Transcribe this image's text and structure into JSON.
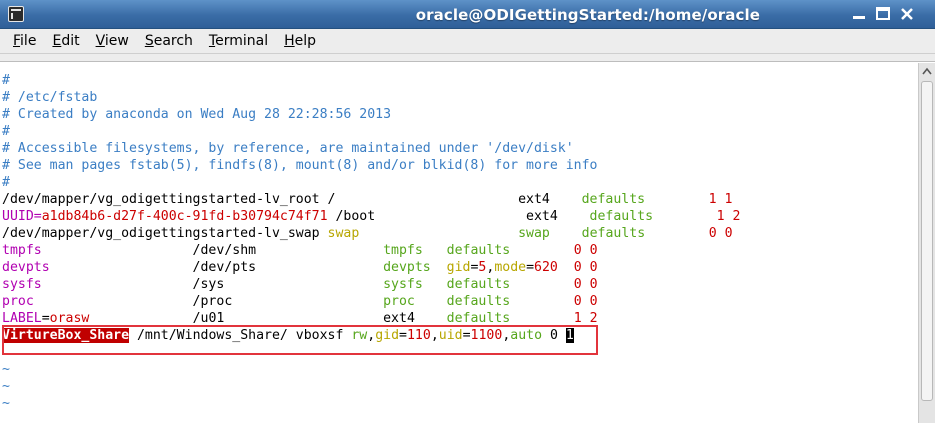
{
  "window": {
    "title": "oracle@ODIGettingStarted:/home/oracle"
  },
  "menu": {
    "items": [
      {
        "first": "F",
        "rest": "ile"
      },
      {
        "first": "E",
        "rest": "dit"
      },
      {
        "first": "V",
        "rest": "iew"
      },
      {
        "first": "S",
        "rest": "earch"
      },
      {
        "first": "T",
        "rest": "erminal"
      },
      {
        "first": "H",
        "rest": "elp"
      }
    ]
  },
  "terminal": {
    "lines": [
      [
        {
          "t": "#",
          "c": "cmt"
        }
      ],
      [
        {
          "t": "# /etc/fstab",
          "c": "cmt"
        }
      ],
      [
        {
          "t": "# Created by anaconda on Wed Aug 28 22:28:56 2013",
          "c": "cmt"
        }
      ],
      [
        {
          "t": "#",
          "c": "cmt"
        }
      ],
      [
        {
          "t": "# Accessible filesystems, by reference, are maintained under '/dev/disk'",
          "c": "cmt"
        }
      ],
      [
        {
          "t": "# See man pages fstab(5), findfs(8), mount(8) and/or blkid(8) for more info",
          "c": "cmt"
        }
      ],
      [
        {
          "t": "#",
          "c": "cmt"
        }
      ],
      [
        {
          "t": "/dev/mapper/vg_odigettingstarted-lv_root /                       ext4    ",
          "c": ""
        },
        {
          "t": "defaults",
          "c": "grn"
        },
        {
          "t": "        ",
          "c": ""
        },
        {
          "t": "1 1",
          "c": "red"
        }
      ],
      [
        {
          "t": "UUID=",
          "c": "mag"
        },
        {
          "t": "a1db84b6-d27f-400c-91fd-b30794c74f71",
          "c": "red"
        },
        {
          "t": " /boot                   ext4    ",
          "c": ""
        },
        {
          "t": "defaults",
          "c": "grn"
        },
        {
          "t": "        ",
          "c": ""
        },
        {
          "t": "1 2",
          "c": "red"
        }
      ],
      [
        {
          "t": "/dev/mapper/vg_odigettingstarted-lv_swap ",
          "c": ""
        },
        {
          "t": "swap",
          "c": "ylw"
        },
        {
          "t": "                    ",
          "c": ""
        },
        {
          "t": "swap",
          "c": "grn"
        },
        {
          "t": "    ",
          "c": ""
        },
        {
          "t": "defaults",
          "c": "grn"
        },
        {
          "t": "        ",
          "c": ""
        },
        {
          "t": "0 0",
          "c": "red"
        }
      ],
      [
        {
          "t": "tmpfs",
          "c": "mag"
        },
        {
          "t": "                   /dev/shm                ",
          "c": ""
        },
        {
          "t": "tmpfs",
          "c": "grn"
        },
        {
          "t": "   ",
          "c": ""
        },
        {
          "t": "defaults",
          "c": "grn"
        },
        {
          "t": "        ",
          "c": ""
        },
        {
          "t": "0 0",
          "c": "red"
        }
      ],
      [
        {
          "t": "devpts",
          "c": "mag"
        },
        {
          "t": "                  /dev/pts                ",
          "c": ""
        },
        {
          "t": "devpts",
          "c": "grn"
        },
        {
          "t": "  ",
          "c": ""
        },
        {
          "t": "gid",
          "c": "ylw"
        },
        {
          "t": "=",
          "c": ""
        },
        {
          "t": "5",
          "c": "red"
        },
        {
          "t": ",",
          "c": ""
        },
        {
          "t": "mode",
          "c": "ylw"
        },
        {
          "t": "=",
          "c": ""
        },
        {
          "t": "620",
          "c": "red"
        },
        {
          "t": "  ",
          "c": ""
        },
        {
          "t": "0 0",
          "c": "red"
        }
      ],
      [
        {
          "t": "sysfs",
          "c": "mag"
        },
        {
          "t": "                   /sys                    ",
          "c": ""
        },
        {
          "t": "sysfs",
          "c": "grn"
        },
        {
          "t": "   ",
          "c": ""
        },
        {
          "t": "defaults",
          "c": "grn"
        },
        {
          "t": "        ",
          "c": ""
        },
        {
          "t": "0 0",
          "c": "red"
        }
      ],
      [
        {
          "t": "proc",
          "c": "mag"
        },
        {
          "t": "                    /proc                   ",
          "c": ""
        },
        {
          "t": "proc",
          "c": "grn"
        },
        {
          "t": "    ",
          "c": ""
        },
        {
          "t": "defaults",
          "c": "grn"
        },
        {
          "t": "        ",
          "c": ""
        },
        {
          "t": "0 0",
          "c": "red"
        }
      ],
      [
        {
          "t": "LABEL",
          "c": "mag"
        },
        {
          "t": "=",
          "c": ""
        },
        {
          "t": "orasw",
          "c": "red"
        },
        {
          "t": "             /u01                    ext4    ",
          "c": ""
        },
        {
          "t": "defaults",
          "c": "grn"
        },
        {
          "t": "        ",
          "c": ""
        },
        {
          "t": "1 2",
          "c": "red"
        }
      ],
      [
        {
          "t": "VirtureBox_Share",
          "c": "hl"
        },
        {
          "t": " /mnt/Windows_Share/ vboxsf ",
          "c": ""
        },
        {
          "t": "rw",
          "c": "grn"
        },
        {
          "t": ",",
          "c": ""
        },
        {
          "t": "gid",
          "c": "ylw"
        },
        {
          "t": "=",
          "c": ""
        },
        {
          "t": "110",
          "c": "red"
        },
        {
          "t": ",",
          "c": ""
        },
        {
          "t": "uid",
          "c": "ylw"
        },
        {
          "t": "=",
          "c": ""
        },
        {
          "t": "1100",
          "c": "red"
        },
        {
          "t": ",",
          "c": ""
        },
        {
          "t": "auto",
          "c": "grn"
        },
        {
          "t": " 0 ",
          "c": ""
        },
        {
          "t": "1",
          "c": "cursor"
        }
      ],
      [
        {
          "t": "",
          "c": ""
        }
      ],
      [
        {
          "t": "~",
          "c": "blu"
        }
      ],
      [
        {
          "t": "~",
          "c": "blu"
        }
      ],
      [
        {
          "t": "~",
          "c": "blu"
        }
      ]
    ]
  },
  "colors": {
    "comment": "#3b7ec4",
    "keyword": "#56a61c",
    "option": "#b7a600",
    "number": "#cc0000",
    "label": "#b100b1",
    "highlight_bg": "#c00000",
    "annotation_box": "#e2343c"
  },
  "icons": {
    "app": "terminal-icon",
    "minimize": "minimize-icon",
    "maximize": "maximize-icon",
    "close": "close-icon",
    "scroll_up": "scroll-up-arrow-icon"
  }
}
